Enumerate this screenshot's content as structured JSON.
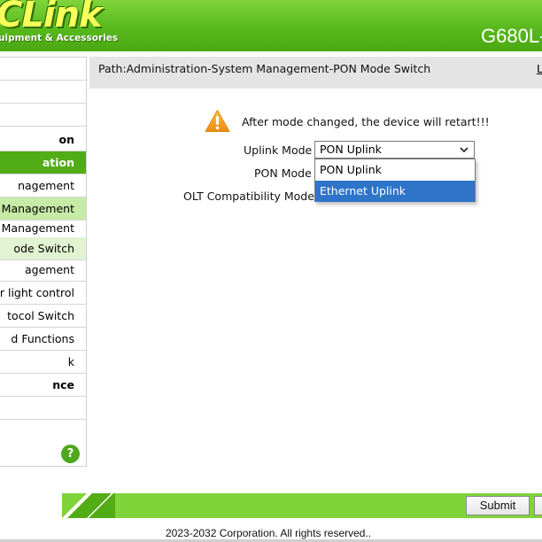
{
  "header": {
    "logo_text": "CLink",
    "tagline": "uipment & Accessories",
    "model": "G680L-"
  },
  "sidebar": {
    "items": [
      {
        "label": ""
      },
      {
        "label": ""
      },
      {
        "label": "on"
      },
      {
        "label": "ation"
      },
      {
        "label": "nagement"
      },
      {
        "label": "Management"
      },
      {
        "label": "n Management"
      },
      {
        "label": "ode Switch"
      },
      {
        "label": "agement"
      },
      {
        "label": "r light control"
      },
      {
        "label": "tocol Switch"
      },
      {
        "label": "d Functions"
      },
      {
        "label": "k"
      },
      {
        "label": "nce"
      },
      {
        "label": ""
      }
    ],
    "help_icon": "help-icon"
  },
  "path": {
    "text": "Path:Administration-System Management-PON Mode Switch",
    "logout_label": "L"
  },
  "form": {
    "warning": "After mode changed, the device will retart!!!",
    "uplink_label": "Uplink Mode",
    "uplink_value": "PON Uplink",
    "pon_mode_label": "PON Mode",
    "olt_label": "OLT Compatibility Mode",
    "options": [
      "PON Uplink",
      "Ethernet Uplink"
    ],
    "highlighted_option": "Ethernet Uplink"
  },
  "footer": {
    "submit_label": "Submit",
    "copyright": "2023-2032 Corporation. All rights reserved.."
  },
  "colors": {
    "brand_green": "#52ac16",
    "header_green": "#58b91c",
    "selected_blue": "#2e74c9",
    "warning_orange": "#f0a020"
  }
}
